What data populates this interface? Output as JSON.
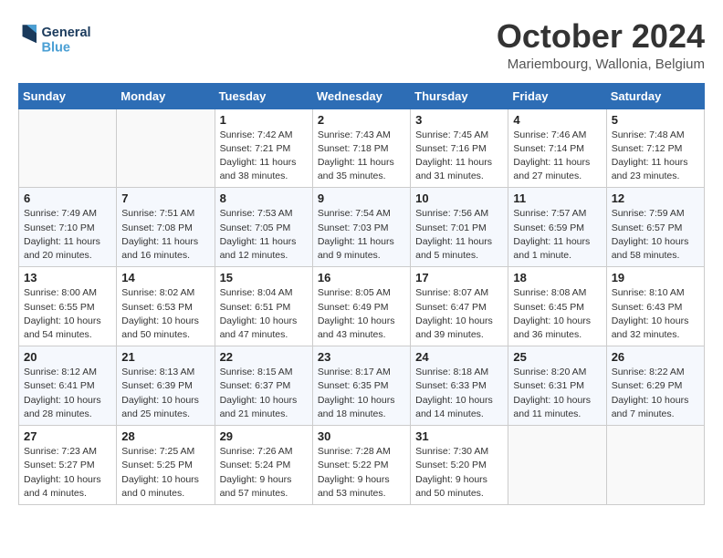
{
  "header": {
    "logo_general": "General",
    "logo_blue": "Blue",
    "month": "October 2024",
    "location": "Mariembourg, Wallonia, Belgium"
  },
  "days_of_week": [
    "Sunday",
    "Monday",
    "Tuesday",
    "Wednesday",
    "Thursday",
    "Friday",
    "Saturday"
  ],
  "weeks": [
    [
      {
        "day": "",
        "sunrise": "",
        "sunset": "",
        "daylight": ""
      },
      {
        "day": "",
        "sunrise": "",
        "sunset": "",
        "daylight": ""
      },
      {
        "day": "1",
        "sunrise": "Sunrise: 7:42 AM",
        "sunset": "Sunset: 7:21 PM",
        "daylight": "Daylight: 11 hours and 38 minutes."
      },
      {
        "day": "2",
        "sunrise": "Sunrise: 7:43 AM",
        "sunset": "Sunset: 7:18 PM",
        "daylight": "Daylight: 11 hours and 35 minutes."
      },
      {
        "day": "3",
        "sunrise": "Sunrise: 7:45 AM",
        "sunset": "Sunset: 7:16 PM",
        "daylight": "Daylight: 11 hours and 31 minutes."
      },
      {
        "day": "4",
        "sunrise": "Sunrise: 7:46 AM",
        "sunset": "Sunset: 7:14 PM",
        "daylight": "Daylight: 11 hours and 27 minutes."
      },
      {
        "day": "5",
        "sunrise": "Sunrise: 7:48 AM",
        "sunset": "Sunset: 7:12 PM",
        "daylight": "Daylight: 11 hours and 23 minutes."
      }
    ],
    [
      {
        "day": "6",
        "sunrise": "Sunrise: 7:49 AM",
        "sunset": "Sunset: 7:10 PM",
        "daylight": "Daylight: 11 hours and 20 minutes."
      },
      {
        "day": "7",
        "sunrise": "Sunrise: 7:51 AM",
        "sunset": "Sunset: 7:08 PM",
        "daylight": "Daylight: 11 hours and 16 minutes."
      },
      {
        "day": "8",
        "sunrise": "Sunrise: 7:53 AM",
        "sunset": "Sunset: 7:05 PM",
        "daylight": "Daylight: 11 hours and 12 minutes."
      },
      {
        "day": "9",
        "sunrise": "Sunrise: 7:54 AM",
        "sunset": "Sunset: 7:03 PM",
        "daylight": "Daylight: 11 hours and 9 minutes."
      },
      {
        "day": "10",
        "sunrise": "Sunrise: 7:56 AM",
        "sunset": "Sunset: 7:01 PM",
        "daylight": "Daylight: 11 hours and 5 minutes."
      },
      {
        "day": "11",
        "sunrise": "Sunrise: 7:57 AM",
        "sunset": "Sunset: 6:59 PM",
        "daylight": "Daylight: 11 hours and 1 minute."
      },
      {
        "day": "12",
        "sunrise": "Sunrise: 7:59 AM",
        "sunset": "Sunset: 6:57 PM",
        "daylight": "Daylight: 10 hours and 58 minutes."
      }
    ],
    [
      {
        "day": "13",
        "sunrise": "Sunrise: 8:00 AM",
        "sunset": "Sunset: 6:55 PM",
        "daylight": "Daylight: 10 hours and 54 minutes."
      },
      {
        "day": "14",
        "sunrise": "Sunrise: 8:02 AM",
        "sunset": "Sunset: 6:53 PM",
        "daylight": "Daylight: 10 hours and 50 minutes."
      },
      {
        "day": "15",
        "sunrise": "Sunrise: 8:04 AM",
        "sunset": "Sunset: 6:51 PM",
        "daylight": "Daylight: 10 hours and 47 minutes."
      },
      {
        "day": "16",
        "sunrise": "Sunrise: 8:05 AM",
        "sunset": "Sunset: 6:49 PM",
        "daylight": "Daylight: 10 hours and 43 minutes."
      },
      {
        "day": "17",
        "sunrise": "Sunrise: 8:07 AM",
        "sunset": "Sunset: 6:47 PM",
        "daylight": "Daylight: 10 hours and 39 minutes."
      },
      {
        "day": "18",
        "sunrise": "Sunrise: 8:08 AM",
        "sunset": "Sunset: 6:45 PM",
        "daylight": "Daylight: 10 hours and 36 minutes."
      },
      {
        "day": "19",
        "sunrise": "Sunrise: 8:10 AM",
        "sunset": "Sunset: 6:43 PM",
        "daylight": "Daylight: 10 hours and 32 minutes."
      }
    ],
    [
      {
        "day": "20",
        "sunrise": "Sunrise: 8:12 AM",
        "sunset": "Sunset: 6:41 PM",
        "daylight": "Daylight: 10 hours and 28 minutes."
      },
      {
        "day": "21",
        "sunrise": "Sunrise: 8:13 AM",
        "sunset": "Sunset: 6:39 PM",
        "daylight": "Daylight: 10 hours and 25 minutes."
      },
      {
        "day": "22",
        "sunrise": "Sunrise: 8:15 AM",
        "sunset": "Sunset: 6:37 PM",
        "daylight": "Daylight: 10 hours and 21 minutes."
      },
      {
        "day": "23",
        "sunrise": "Sunrise: 8:17 AM",
        "sunset": "Sunset: 6:35 PM",
        "daylight": "Daylight: 10 hours and 18 minutes."
      },
      {
        "day": "24",
        "sunrise": "Sunrise: 8:18 AM",
        "sunset": "Sunset: 6:33 PM",
        "daylight": "Daylight: 10 hours and 14 minutes."
      },
      {
        "day": "25",
        "sunrise": "Sunrise: 8:20 AM",
        "sunset": "Sunset: 6:31 PM",
        "daylight": "Daylight: 10 hours and 11 minutes."
      },
      {
        "day": "26",
        "sunrise": "Sunrise: 8:22 AM",
        "sunset": "Sunset: 6:29 PM",
        "daylight": "Daylight: 10 hours and 7 minutes."
      }
    ],
    [
      {
        "day": "27",
        "sunrise": "Sunrise: 7:23 AM",
        "sunset": "Sunset: 5:27 PM",
        "daylight": "Daylight: 10 hours and 4 minutes."
      },
      {
        "day": "28",
        "sunrise": "Sunrise: 7:25 AM",
        "sunset": "Sunset: 5:25 PM",
        "daylight": "Daylight: 10 hours and 0 minutes."
      },
      {
        "day": "29",
        "sunrise": "Sunrise: 7:26 AM",
        "sunset": "Sunset: 5:24 PM",
        "daylight": "Daylight: 9 hours and 57 minutes."
      },
      {
        "day": "30",
        "sunrise": "Sunrise: 7:28 AM",
        "sunset": "Sunset: 5:22 PM",
        "daylight": "Daylight: 9 hours and 53 minutes."
      },
      {
        "day": "31",
        "sunrise": "Sunrise: 7:30 AM",
        "sunset": "Sunset: 5:20 PM",
        "daylight": "Daylight: 9 hours and 50 minutes."
      },
      {
        "day": "",
        "sunrise": "",
        "sunset": "",
        "daylight": ""
      },
      {
        "day": "",
        "sunrise": "",
        "sunset": "",
        "daylight": ""
      }
    ]
  ]
}
